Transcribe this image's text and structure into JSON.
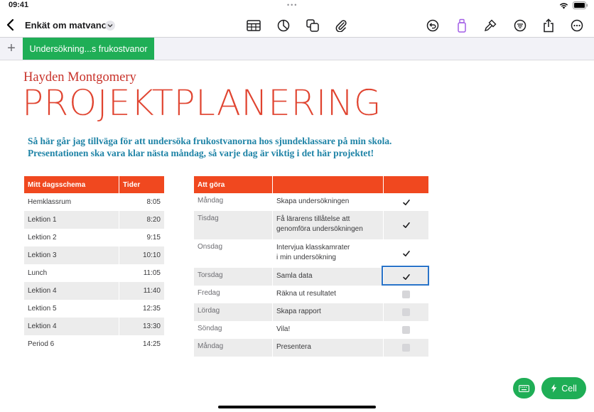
{
  "status": {
    "time": "09:41",
    "dots": "•••"
  },
  "toolbar": {
    "title": "Enkät om matvanor",
    "icons": [
      "back-chevron-icon",
      "table-icon",
      "chart-icon",
      "shapes-icon",
      "attachment-icon",
      "undo-icon",
      "paintbrush-icon",
      "format-icon",
      "filter-icon",
      "share-icon",
      "more-icon"
    ]
  },
  "sheet": {
    "add": "+",
    "tab_label": "Undersökning...s frukostvanor",
    "accent": "#1fae56"
  },
  "document": {
    "author": "Hayden Montgomery",
    "title": "PROJEKTPLANERING",
    "intro_line1": "Så här går jag tillväga för att undersöka frukostvanorna hos sjundeklassare på min skola.",
    "intro_line2": "Presentationen ska vara klar nästa måndag, så varje dag är viktig i det här projektet!"
  },
  "schedule": {
    "headers": [
      "Mitt dagsschema",
      "Tider"
    ],
    "rows": [
      [
        "Hemklassrum",
        "8:05"
      ],
      [
        "Lektion 1",
        "8:20"
      ],
      [
        "Lektion 2",
        "9:15"
      ],
      [
        "Lektion 3",
        "10:10"
      ],
      [
        "Lunch",
        "11:05"
      ],
      [
        "Lektion 4",
        "11:40"
      ],
      [
        "Lektion 5",
        "12:35"
      ],
      [
        "Lektion 4",
        "13:30"
      ],
      [
        "Period 6",
        "14:25"
      ]
    ]
  },
  "todo": {
    "headers": [
      "Att göra",
      "",
      ""
    ],
    "rows": [
      {
        "day": "Måndag",
        "task": "Skapa undersökningen",
        "done": true
      },
      {
        "day": "Tisdag",
        "task": "Få lärarens tillåtelse att\ngenomföra undersökningen",
        "done": true
      },
      {
        "day": "Onsdag",
        "task": "Intervjua klasskamrater\ni min undersökning",
        "done": true
      },
      {
        "day": "Torsdag",
        "task": "Samla data",
        "done": true
      },
      {
        "day": "Fredag",
        "task": "Räkna ut resultatet",
        "done": false
      },
      {
        "day": "Lördag",
        "task": "Skapa rapport",
        "done": false
      },
      {
        "day": "Söndag",
        "task": "Vila!",
        "done": false
      },
      {
        "day": "Måndag",
        "task": "Presentera",
        "done": false
      }
    ]
  },
  "floating": {
    "cell_label": "Cell"
  },
  "colors": {
    "header": "#f0481f",
    "title": "#e0432f",
    "author": "#c8322a",
    "intro": "#1e83a6",
    "selection": "#2a74c9"
  }
}
